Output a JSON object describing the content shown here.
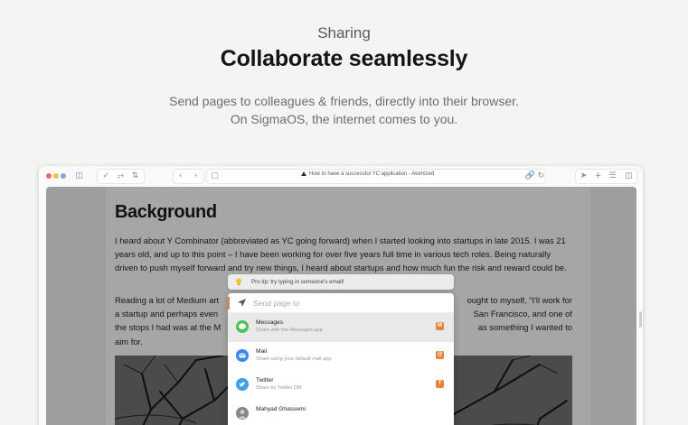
{
  "hero": {
    "eyebrow": "Sharing",
    "headline": "Collaborate seamlessly",
    "subtitle_line1": "Send pages to colleagues & friends, directly into their browser.",
    "subtitle_line2": "On SigmaOS, the internet comes to you."
  },
  "browser": {
    "page_title": "How to have a successful YC application - Atomized",
    "traffic_light_colors": [
      "#ee6a5f",
      "#f5be4f",
      "#7aa8e8"
    ],
    "toolbar_icons": [
      "sidebar-icon",
      "check-icon",
      "split-icon",
      "swap-icon",
      "back-icon",
      "forward-icon",
      "tab-icon",
      "link-icon",
      "reload-icon",
      "send-icon",
      "plus-icon",
      "layers-icon",
      "panel-icon"
    ]
  },
  "article": {
    "heading": "Background",
    "paragraph1": "I heard about Y Combinator (abbreviated as YC going forward) when I started looking into startups in late 2015. I was 21 years old, and up to this point – I have been working for over five years full time in various tech roles. Being naturally driven to push myself forward and try new things, I heard about startups and how much fun the risk and reward could be.",
    "paragraph2_left": "Reading a lot of Medium art",
    "paragraph2_right": "ought to myself, “I'll work for",
    "paragraph2_line2_left": "a startup and perhaps even",
    "paragraph2_line2_right": "San Francisco, and one of",
    "paragraph2_line3_left": "the stops I had was at the M",
    "paragraph2_line3_right": "as something I wanted to",
    "paragraph2_line4": "aim for."
  },
  "share": {
    "tip": "Pro tip: try typing in someone's email!",
    "placeholder": "Send page to",
    "accent_color": "#e8823a",
    "options": [
      {
        "title": "Messages",
        "desc": "Share with the Messages app",
        "key": "M",
        "icon_color": "#4cc35a"
      },
      {
        "title": "Mail",
        "desc": "Share using your default mail app",
        "key": "@",
        "icon_color": "#3a86e8"
      },
      {
        "title": "Twitter",
        "desc": "Share by Twitter DM",
        "key": "T",
        "icon_color": "#3aa0e8"
      },
      {
        "title": "Mahyad Ghassemi",
        "desc": "",
        "key": "",
        "icon_color": "#888888"
      }
    ]
  }
}
